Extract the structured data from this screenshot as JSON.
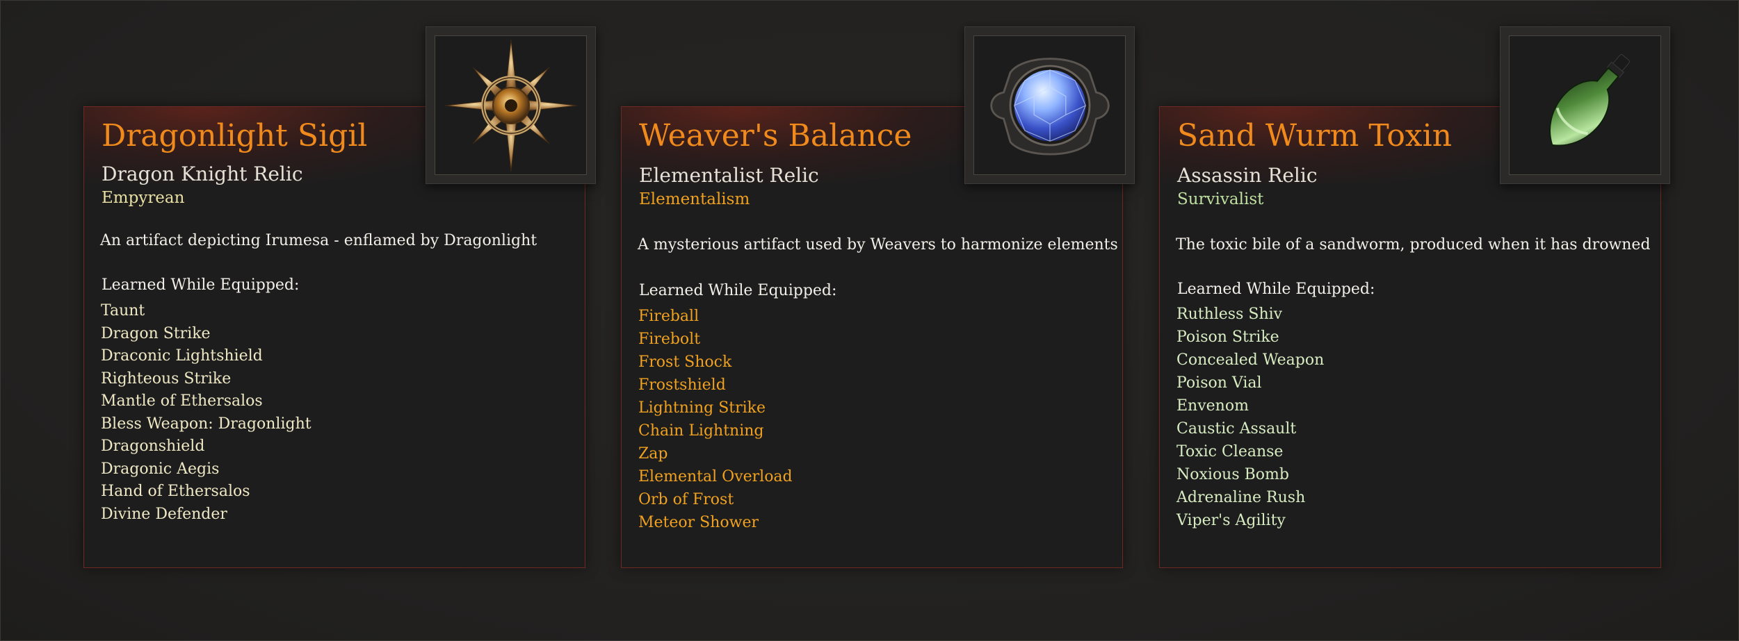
{
  "relics": [
    {
      "name": "Dragonlight Sigil",
      "class": "Dragon Knight Relic",
      "school": "Empyrean",
      "school_color": "#e9e0a3",
      "ability_color": "#efe8c4",
      "description": "An artifact depicting Irumesa - enflamed by Dragonlight",
      "learned_label": "Learned While Equipped:",
      "icon": "compass-star-icon",
      "abilities": [
        "Taunt",
        "Dragon Strike",
        "Draconic Lightshield",
        "Righteous Strike",
        "Mantle of Ethersalos",
        "Bless Weapon: Dragonlight",
        "Dragonshield",
        "Dragonic Aegis",
        "Hand of Ethersalos",
        "Divine Defender"
      ]
    },
    {
      "name": "Weaver's Balance",
      "class": "Elementalist Relic",
      "school": "Elementalism",
      "school_color": "#f0a11f",
      "ability_color": "#f0a11f",
      "description": "A mysterious artifact used by Weavers to harmonize elements",
      "learned_label": "Learned While Equipped:",
      "icon": "blue-gem-icon",
      "abilities": [
        "Fireball",
        "Firebolt",
        "Frost Shock",
        "Frostshield",
        "Lightning Strike",
        "Chain Lightning",
        "Zap",
        "Elemental Overload",
        "Orb of Frost",
        "Meteor Shower"
      ]
    },
    {
      "name": "Sand Wurm Toxin",
      "class": "Assassin Relic",
      "school": "Survivalist",
      "school_color": "#bfe0a0",
      "ability_color": "#d8ecc2",
      "description": "The toxic bile of a sandworm, produced when it has drowned",
      "learned_label": "Learned While Equipped:",
      "icon": "poison-vial-icon",
      "abilities": [
        "Ruthless Shiv",
        "Poison Strike",
        "Concealed Weapon",
        "Poison Vial",
        "Envenom",
        "Caustic Assault",
        "Toxic Cleanse",
        "Noxious Bomb",
        "Adrenaline Rush",
        "Viper's Agility"
      ]
    }
  ]
}
